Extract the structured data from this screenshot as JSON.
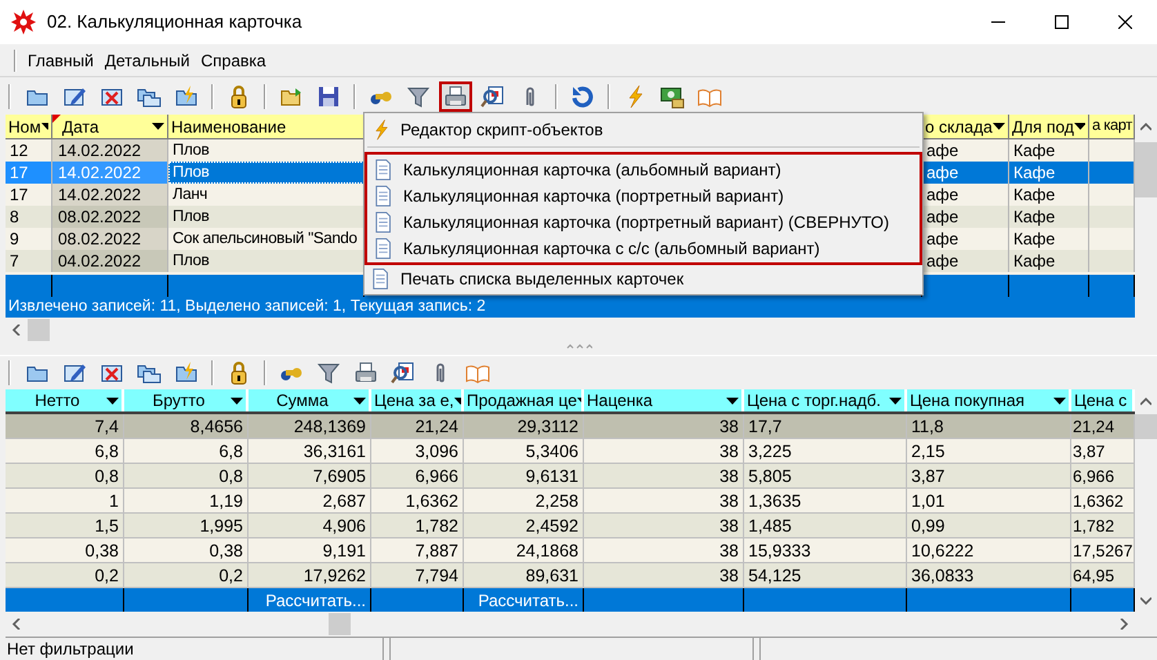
{
  "window": {
    "title": "02. Калькуляционная карточка"
  },
  "menu": [
    "Главный",
    "Детальный",
    "Справка"
  ],
  "toolbar": [
    {
      "kind": "folder"
    },
    {
      "kind": "edit"
    },
    {
      "kind": "delete"
    },
    {
      "kind": "copy"
    },
    {
      "kind": "script"
    },
    {
      "kind": "separator"
    },
    {
      "kind": "lock"
    },
    {
      "kind": "separator"
    },
    {
      "kind": "open"
    },
    {
      "kind": "save"
    },
    {
      "kind": "separator"
    },
    {
      "kind": "binoculars"
    },
    {
      "kind": "filter"
    },
    {
      "kind": "printer",
      "outlined": true
    },
    {
      "kind": "preview"
    },
    {
      "kind": "clip"
    },
    {
      "kind": "separator"
    },
    {
      "kind": "refresh"
    },
    {
      "kind": "separator"
    },
    {
      "kind": "lightning"
    },
    {
      "kind": "money"
    },
    {
      "kind": "book"
    }
  ],
  "upper_table": {
    "columns": [
      {
        "label": "Ном"
      },
      {
        "label": "Дата"
      },
      {
        "label": "Наименование"
      },
      {},
      {
        "label": "о склада"
      },
      {
        "label": "Для под"
      },
      {
        "label": "а карт"
      }
    ],
    "rows": [
      {
        "selected": false,
        "cells": [
          "12",
          "14.02.2022",
          "Плов",
          null,
          "афе",
          "Кафе",
          null
        ]
      },
      {
        "selected": true,
        "cells": [
          "17",
          "14.02.2022",
          "Плов",
          null,
          "афе",
          "Кафе",
          null
        ]
      },
      {
        "selected": false,
        "cells": [
          "17",
          "14.02.2022",
          "Ланч",
          null,
          "афе",
          "Кафе",
          null
        ]
      },
      {
        "selected": false,
        "cells": [
          "8",
          "08.02.2022",
          "Плов",
          null,
          "афе",
          "Кафе",
          null
        ]
      },
      {
        "selected": false,
        "cells": [
          "9",
          "08.02.2022",
          "Сок апельсиновый \"Sando",
          null,
          "афе",
          "Кафе",
          null
        ]
      },
      {
        "selected": false,
        "cells": [
          "7",
          "04.02.2022",
          "Плов",
          null,
          "афе",
          "Кафе",
          null
        ]
      }
    ],
    "status": "Извлечено записей: 11, Выделено записей: 1, Текущая запись: 2"
  },
  "popup_menu": [
    {
      "kind": "lightning",
      "label": "Редактор скрипт-объектов"
    },
    {
      "kind": "separator"
    },
    {
      "kind": "document",
      "label": "Калькуляционная карточка  (альбомный вариант)",
      "outlined": true
    },
    {
      "kind": "document",
      "label": "Калькуляционная карточка  (портретный вариант)",
      "outlined": true
    },
    {
      "kind": "document",
      "label": "Калькуляционная карточка  (портретный вариант) (СВЕРНУТО)",
      "outlined": true
    },
    {
      "kind": "document",
      "label": "Калькуляционная карточка с с/с (альбомный вариант)",
      "outlined": true
    },
    {
      "kind": "document",
      "label": "Печать списка выделенных карточек"
    }
  ],
  "lower_toolbar": [
    {
      "kind": "folder"
    },
    {
      "kind": "edit"
    },
    {
      "kind": "delete"
    },
    {
      "kind": "copy"
    },
    {
      "kind": "script"
    },
    {
      "kind": "separator"
    },
    {
      "kind": "lock"
    },
    {
      "kind": "separator"
    },
    {
      "kind": "binoculars"
    },
    {
      "kind": "filter"
    },
    {
      "kind": "printer"
    },
    {
      "kind": "preview"
    },
    {
      "kind": "clip"
    },
    {
      "kind": "book"
    }
  ],
  "lower_table": {
    "columns": [
      {
        "label": "Нетто"
      },
      {
        "label": "Брутто"
      },
      {
        "label": "Сумма",
        "footer": "Рассчитать..."
      },
      {
        "label": "Цена за е,"
      },
      {
        "label": "Продажная це",
        "footer": "Рассчитать..."
      },
      {
        "label": "Наценка"
      },
      {
        "label": "Цена с торг.надб."
      },
      {
        "label": "Цена покупная"
      },
      {
        "label": "Цена с"
      }
    ],
    "rows": [
      {
        "selected": true,
        "cells": [
          "7,4",
          "8,4656",
          "248,1369",
          "21,24",
          "29,3112",
          "38",
          "17,7",
          "11,8",
          "21,24"
        ]
      },
      {
        "selected": false,
        "cells": [
          "6,8",
          "6,8",
          "36,3161",
          "3,096",
          "5,3406",
          "38",
          "3,225",
          "2,15",
          "3,87"
        ]
      },
      {
        "selected": false,
        "cells": [
          "0,8",
          "0,8",
          "7,6905",
          "6,966",
          "9,6131",
          "38",
          "5,805",
          "3,87",
          "6,966"
        ]
      },
      {
        "selected": false,
        "cells": [
          "1",
          "1,19",
          "2,687",
          "1,6362",
          "2,258",
          "38",
          "1,3635",
          "1,01",
          "1,6362"
        ]
      },
      {
        "selected": false,
        "cells": [
          "1,5",
          "1,995",
          "4,906",
          "1,782",
          "2,4592",
          "38",
          "1,485",
          "0,99",
          "1,782"
        ]
      },
      {
        "selected": false,
        "cells": [
          "0,38",
          "0,38",
          "9,191",
          "7,887",
          "24,1868",
          "38",
          "15,9333",
          "10,6222",
          "17,5267"
        ]
      },
      {
        "selected": false,
        "cells": [
          "0,2",
          "0,2",
          "17,9262",
          "7,794",
          "89,631",
          "38",
          "54,125",
          "36,0833",
          "64,95"
        ]
      }
    ]
  },
  "status_bar": "Нет фильтрации"
}
